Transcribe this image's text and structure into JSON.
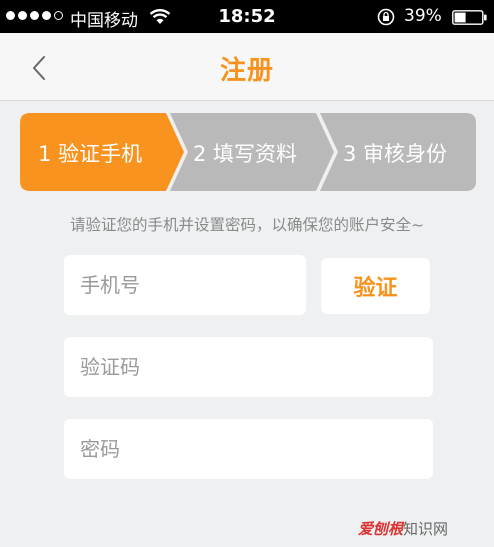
{
  "status_bar": {
    "carrier": "中国移动",
    "time": "18:52",
    "battery_percent": "39%",
    "signal_bars_filled": 4,
    "signal_bars_total": 5
  },
  "nav": {
    "title": "注册",
    "back_icon": "chevron-left-icon"
  },
  "steps": [
    {
      "label": "1 验证手机",
      "active": true
    },
    {
      "label": "2 填写资料",
      "active": false
    },
    {
      "label": "3 审核身份",
      "active": false
    }
  ],
  "colors": {
    "accent": "#f7931e",
    "step_inactive": "#b9b9b9",
    "background": "#eef0f1"
  },
  "hint": "请验证您的手机并设置密码，以确保您的账户安全~",
  "form": {
    "phone_placeholder": "手机号",
    "verify_label": "验证",
    "code_placeholder": "验证码",
    "password_placeholder": "密码"
  },
  "watermark": {
    "brand": "爱刨根",
    "site": "知识网"
  }
}
